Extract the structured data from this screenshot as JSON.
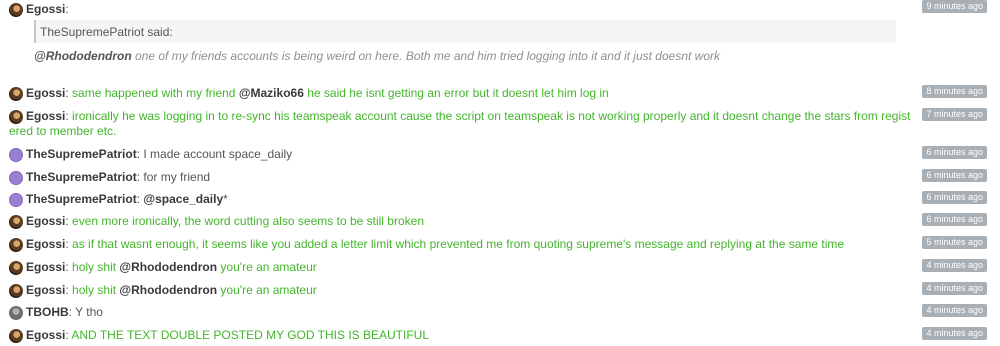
{
  "messages": [
    {
      "author": "Egossi",
      "avatar": "egossi-avatar",
      "time": "9 minutes ago",
      "quote": {
        "header": "TheSupremePatriot said:",
        "mention": "@Rhododendron",
        "text": " one of my friends accounts is being weird on here. Both me and him tried logging into it and it just doesnt work"
      }
    },
    {
      "author": "Egossi",
      "time": "8 minutes ago",
      "pre": "same happened with my friend ",
      "mention": "@Maziko66",
      "post": " he said he isnt getting an error but it doesnt let him log in"
    },
    {
      "author": "Egossi",
      "time": "7 minutes ago",
      "text1": "ironically he was logging in to re-sync his teamspeak account cause the script on teamspeak is not working properly and it doesnt change the stars from regist",
      "text2": "ered to member etc."
    },
    {
      "author": "TheSupremePatriot",
      "time": "6 minutes ago",
      "text": "I made account space_daily"
    },
    {
      "author": "TheSupremePatriot",
      "time": "6 minutes ago",
      "text": "for my friend"
    },
    {
      "author": "TheSupremePatriot",
      "time": "6 minutes ago",
      "mention": "@space_daily",
      "post": "*"
    },
    {
      "author": "Egossi",
      "time": "6 minutes ago",
      "text": "even more ironically, the word cutting also seems to be still broken"
    },
    {
      "author": "Egossi",
      "time": "5 minutes ago",
      "text": "as if that wasnt enough, it seems like you added a letter limit which prevented me from quoting supreme's message and replying at the same time"
    },
    {
      "author": "Egossi",
      "time": "4 minutes ago",
      "pre": "holy shit ",
      "mention": "@Rhododendron",
      "post": " you're an amateur"
    },
    {
      "author": "Egossi",
      "time": "4 minutes ago",
      "pre": "holy shit ",
      "mention": "@Rhododendron",
      "post": " you're an amateur"
    },
    {
      "author": "TBOHB",
      "time": "4 minutes ago",
      "text": "Y tho"
    },
    {
      "author": "Egossi",
      "time": "4 minutes ago",
      "text": "AND THE TEXT DOUBLE POSTED MY GOD THIS IS BEAUTIFUL"
    }
  ],
  "colon": ":",
  "colors": {
    "green_text": "#43b52b",
    "author": "#3a3a3a",
    "time_badge": "#a8b0b6"
  }
}
